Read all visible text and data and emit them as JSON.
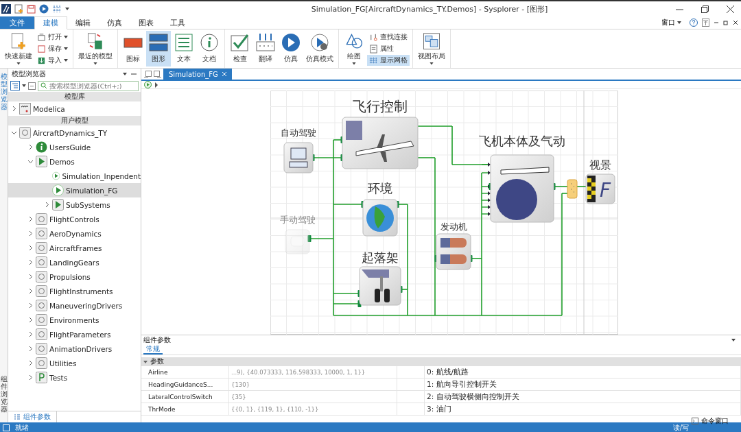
{
  "window": {
    "title": "Simulation_FG[AircraftDynamics_TY.Demos] - Sysplorer - [图形]"
  },
  "ribbon_tabs": [
    {
      "label": "文件",
      "kind": "file",
      "selected": false
    },
    {
      "label": "建模",
      "kind": "tab",
      "selected": true
    },
    {
      "label": "编辑",
      "kind": "tab",
      "selected": false
    },
    {
      "label": "仿真",
      "kind": "tab",
      "selected": false
    },
    {
      "label": "图表",
      "kind": "tab",
      "selected": false
    },
    {
      "label": "工具",
      "kind": "tab",
      "selected": false
    }
  ],
  "window_menu": {
    "label": "窗口"
  },
  "ribbon_groups": [
    {
      "items": [
        {
          "label": "快速新建",
          "kind": "large",
          "dropdown": true,
          "selected": false
        },
        {
          "label": "打开",
          "kind": "small",
          "dropdown": true,
          "selected": false
        },
        {
          "label": "保存",
          "kind": "small",
          "dropdown": true,
          "selected": false
        },
        {
          "label": "导入",
          "kind": "small",
          "dropdown": true,
          "selected": false
        }
      ]
    },
    {
      "items": [
        {
          "label": "最近的模型",
          "kind": "large",
          "dropdown": true,
          "selected": false
        }
      ]
    },
    {
      "items": [
        {
          "label": "图标",
          "kind": "large",
          "dropdown": false,
          "selected": false
        },
        {
          "label": "图形",
          "kind": "large",
          "dropdown": false,
          "selected": true
        },
        {
          "label": "文本",
          "kind": "large",
          "dropdown": false,
          "selected": false
        },
        {
          "label": "文档",
          "kind": "large",
          "dropdown": false,
          "selected": false
        }
      ]
    },
    {
      "items": [
        {
          "label": "检查",
          "kind": "large",
          "dropdown": false,
          "selected": false
        },
        {
          "label": "翻译",
          "kind": "large",
          "dropdown": false,
          "selected": false
        },
        {
          "label": "仿真",
          "kind": "large",
          "dropdown": false,
          "selected": false
        },
        {
          "label": "仿真模式",
          "kind": "large",
          "dropdown": false,
          "selected": false
        }
      ]
    },
    {
      "items": [
        {
          "label": "绘图",
          "kind": "large",
          "dropdown": true,
          "selected": false
        },
        {
          "label": "查找连接",
          "kind": "small",
          "dropdown": false,
          "selected": false
        },
        {
          "label": "属性",
          "kind": "small",
          "dropdown": false,
          "selected": false
        },
        {
          "label": "显示网格",
          "kind": "small",
          "dropdown": false,
          "selected": true
        }
      ]
    },
    {
      "items": [
        {
          "label": "视图布局",
          "kind": "large",
          "dropdown": true,
          "selected": false
        }
      ]
    }
  ],
  "side_tabs": [
    {
      "label": "模型浏览器",
      "selected": true
    },
    {
      "label": "组件浏览器",
      "selected": false
    }
  ],
  "model_browser": {
    "title": "模型浏览器",
    "search_placeholder": "搜索模型浏览器(Ctrl+;)",
    "sections": [
      {
        "title": "模型库",
        "items": [
          {
            "label": "Modelica",
            "kind": "library",
            "expanded": false,
            "selected": false
          }
        ]
      },
      {
        "title": "用户模型",
        "items": [
          {
            "label": "AircraftDynamics_TY",
            "kind": "package",
            "expanded": true,
            "selected": false,
            "children": [
              {
                "label": "UsersGuide",
                "kind": "info",
                "expanded": false,
                "selected": false
              },
              {
                "label": "Demos",
                "kind": "example",
                "expanded": true,
                "selected": false,
                "children": [
                  {
                    "label": "Simulation_Inpendent",
                    "kind": "model",
                    "selected": false
                  },
                  {
                    "label": "Simulation_FG",
                    "kind": "model",
                    "selected": true
                  },
                  {
                    "label": "SubSystems",
                    "kind": "example",
                    "expanded": false,
                    "selected": false
                  }
                ]
              },
              {
                "label": "FlightControls",
                "kind": "package",
                "expanded": false,
                "selected": false
              },
              {
                "label": "AeroDynamics",
                "kind": "package",
                "expanded": false,
                "selected": false
              },
              {
                "label": "AircraftFrames",
                "kind": "package",
                "expanded": false,
                "selected": false
              },
              {
                "label": "LandingGears",
                "kind": "package",
                "expanded": false,
                "selected": false
              },
              {
                "label": "Propulsions",
                "kind": "package",
                "expanded": false,
                "selected": false
              },
              {
                "label": "FlightInstruments",
                "kind": "package",
                "expanded": false,
                "selected": false
              },
              {
                "label": "ManeuveringDrivers",
                "kind": "package",
                "expanded": false,
                "selected": false
              },
              {
                "label": "Environments",
                "kind": "package",
                "expanded": false,
                "selected": false
              },
              {
                "label": "FlightParameters",
                "kind": "package",
                "expanded": false,
                "selected": false
              },
              {
                "label": "AnimationDrivers",
                "kind": "package",
                "expanded": false,
                "selected": false
              },
              {
                "label": "Utilities",
                "kind": "package",
                "expanded": false,
                "selected": false
              },
              {
                "label": "Tests",
                "kind": "tests",
                "expanded": false,
                "selected": false
              }
            ]
          }
        ]
      }
    ]
  },
  "document_tabs": [
    {
      "label": "Simulation_FG",
      "selected": true
    }
  ],
  "diagram": {
    "blocks": [
      {
        "label": "飞行控制",
        "kind": "flight-control",
        "disabled": false
      },
      {
        "label": "自动驾驶",
        "kind": "autopilot",
        "disabled": false
      },
      {
        "label": "环境",
        "kind": "environment",
        "disabled": false
      },
      {
        "label": "手动驾驶",
        "kind": "manual-pilot",
        "disabled": true
      },
      {
        "label": "起落架",
        "kind": "landing-gear",
        "disabled": false
      },
      {
        "label": "发动机",
        "kind": "engine",
        "disabled": false
      },
      {
        "label": "飞机本体及气动",
        "kind": "airframe",
        "disabled": false
      },
      {
        "label": "视景",
        "kind": "visual",
        "disabled": false,
        "glyph": "F"
      }
    ]
  },
  "parameters": {
    "title": "组件参数",
    "tabs": [
      {
        "label": "常规",
        "selected": true
      }
    ],
    "group": "参数",
    "rows": [
      {
        "name": "Airline",
        "value": "...9), {40.073333, 116.598333, 10000, 1, 1}}",
        "description": "0:  航线/航路"
      },
      {
        "name": "HeadingGuidanceS...",
        "value": "{130}",
        "description": "1:  航向导引控制开关"
      },
      {
        "name": "LateralControlSwitch",
        "value": "{35}",
        "description": "2:  自动驾驶横侧向控制开关"
      },
      {
        "name": "ThrMode",
        "value": "{{0, 1}, {119, 1}, {110, -1}}",
        "description": "3:  油门"
      }
    ]
  },
  "bottom_tabs": [
    {
      "label": "组件参数",
      "selected": true
    }
  ],
  "command_window": {
    "label": "命令窗口"
  },
  "status_bar": {
    "left": "就绪",
    "right": "读/写"
  }
}
